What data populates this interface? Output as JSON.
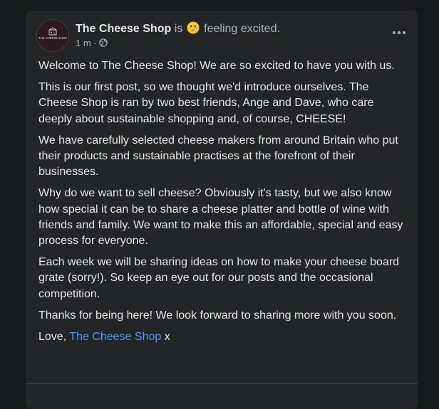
{
  "post": {
    "author": "The Cheese Shop",
    "is_text": "is",
    "feeling_emoji": "grinning-face-emoji",
    "feeling_text": "feeling excited.",
    "timestamp": "1 m",
    "meta_separator": "·",
    "privacy_icon": "globe-icon",
    "avatar_logo_text": "THE CHEESE SHOP",
    "more_icon": "more-horizontal-icon",
    "paragraphs": [
      "Welcome to The Cheese Shop! We are so excited to have you with us.",
      "This is our first post, so we thought we'd introduce ourselves. The Cheese Shop is ran by two best friends, Ange and Dave, who care deeply about sustainable shopping and, of course, CHEESE!",
      "We have carefully selected cheese makers from around Britain who put their products and sustainable practises at the forefront of their businesses.",
      "Why do we want to sell cheese? Obviously it's tasty, but we also know how special it can be to share a cheese platter and bottle of wine with friends and family. We want to make this an affordable, special and easy process for everyone.",
      "Each week we will be sharing ideas on how to make your cheese board grate (sorry!). So keep an eye out for our posts and the occasional competition.",
      "Thanks for being here! We look forward to sharing more with you soon."
    ],
    "signoff_prefix": "Love,",
    "signoff_link": "The Cheese Shop",
    "signoff_suffix": "x"
  },
  "colors": {
    "background": "#18191a",
    "card": "#242526",
    "primary_text": "#e4e6eb",
    "secondary_text": "#b0b3b8",
    "link": "#4599ff"
  }
}
